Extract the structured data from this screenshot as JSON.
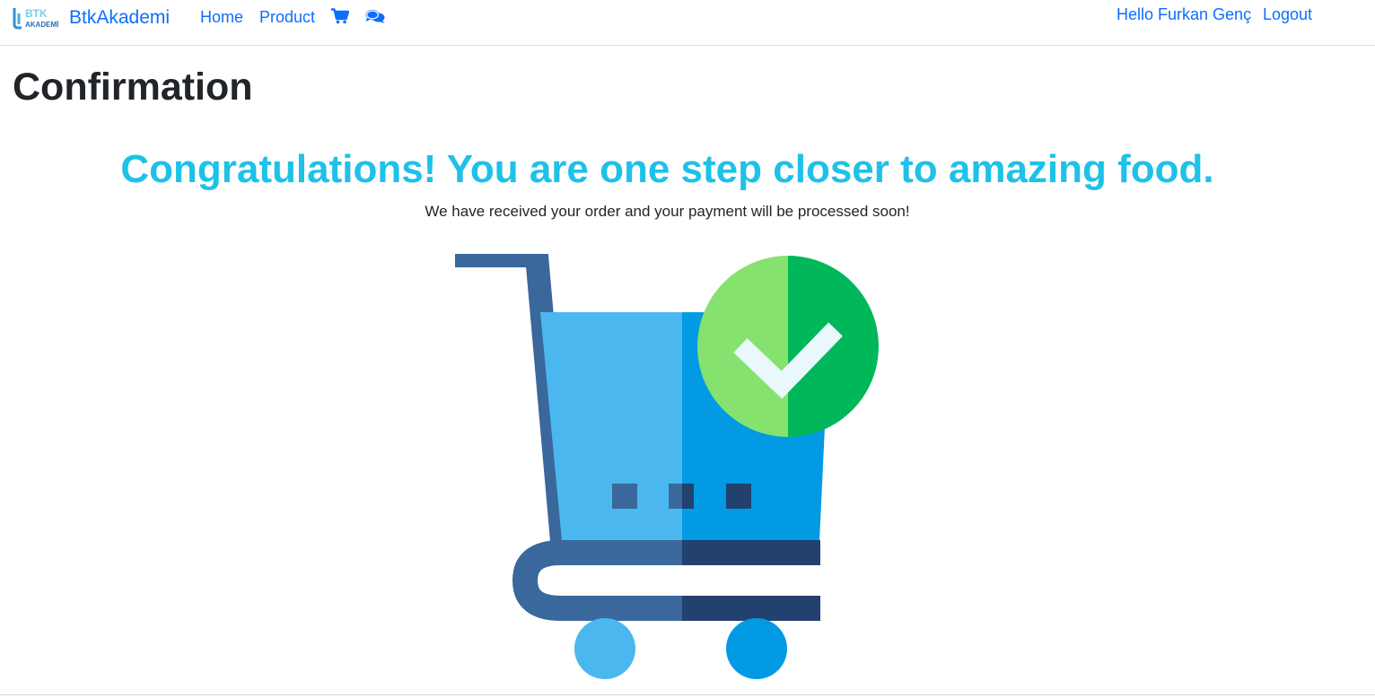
{
  "navbar": {
    "brand_logo_text_top": "BTK",
    "brand_logo_text_bottom": "AKADEMİ",
    "brand_name": "BtkAkademi",
    "links": [
      {
        "label": "Home"
      },
      {
        "label": "Product"
      }
    ],
    "icons": [
      "shopping-cart-icon",
      "chat-bubbles-icon"
    ],
    "greeting": "Hello Furkan Genç",
    "logout_label": "Logout"
  },
  "page": {
    "title": "Confirmation",
    "headline": "Congratulations! You are one step closer to amazing food.",
    "message": "We have received your order and your payment will be processed soon!"
  },
  "illustration": {
    "name": "shopping-cart-with-checkmark",
    "colors": {
      "cart_frame": "#3a679c",
      "cart_frame_dark": "#22416e",
      "basket_left": "#4ab8ee",
      "basket_right": "#039ae4",
      "check_circle_left": "#85e26f",
      "check_circle_right": "#00b75a",
      "check_mark": "#eaf8fb"
    }
  },
  "colors": {
    "link": "#0d6efd",
    "headline": "#1ec1e8",
    "text": "#212529"
  }
}
